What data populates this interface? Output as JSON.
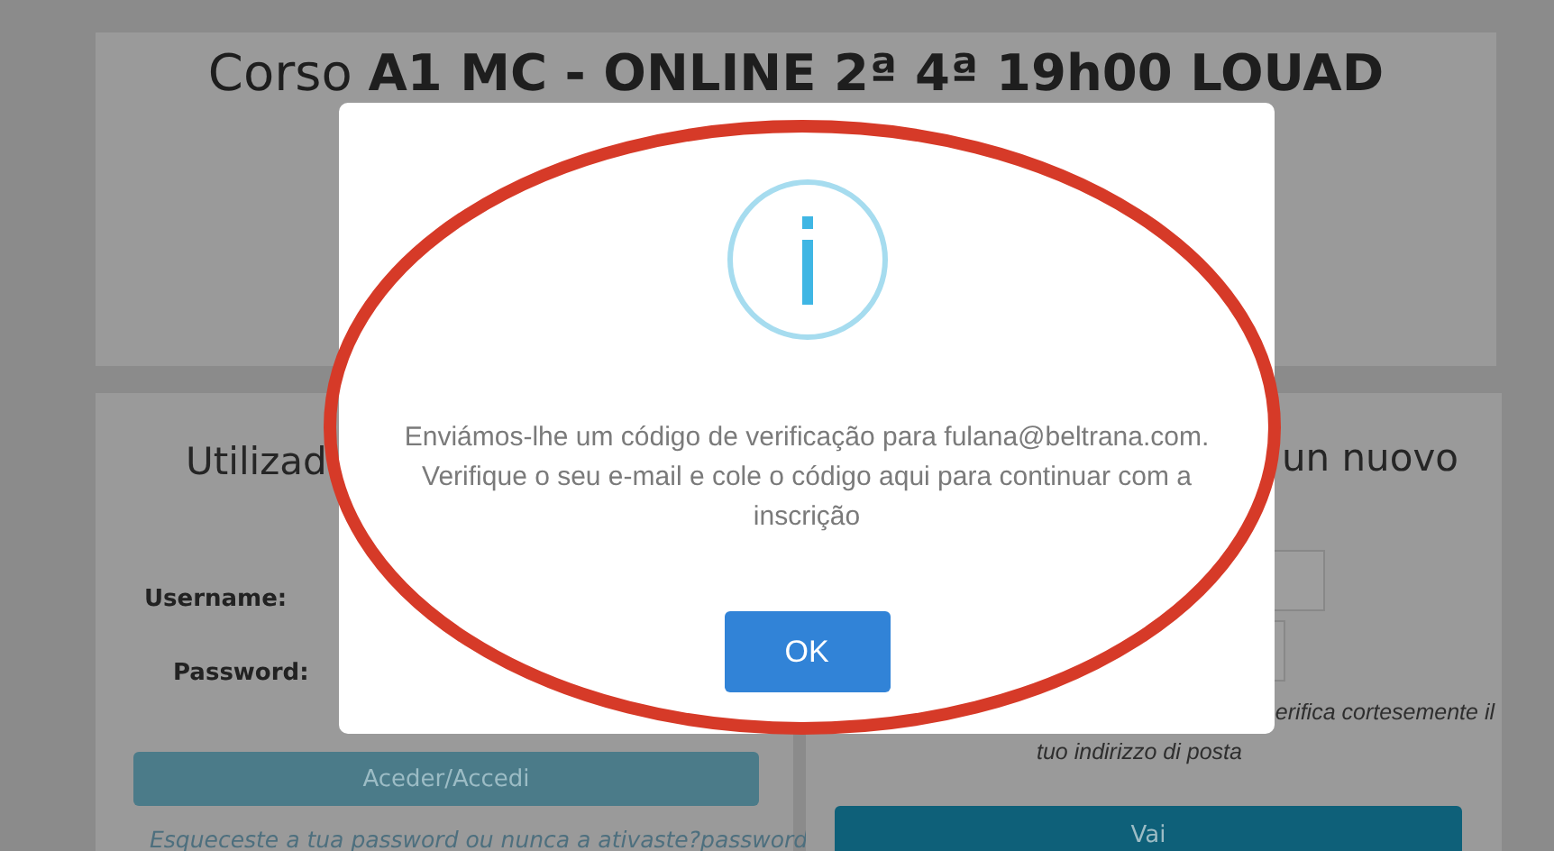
{
  "course_title": "Corso **A1 MC - ONLINE 2ª 4ª 19h00 LOUAD**",
  "login_card": {
    "heading": "Utilizad",
    "username_label": "Username:",
    "password_label": "Password:",
    "button": "Aceder/Accedi",
    "forgot_link": "Esqueceste a tua password ou nunca a ativaste?password"
  },
  "register_card": {
    "heading": "un nuovo",
    "hint_lines": [
      "erifica cortesemente il",
      "tuo indirizzo di posta"
    ],
    "button": "Vai"
  },
  "dialog": {
    "message": "Enviámos-lhe um código de verificação para fulana@beltrana.com. Verifique o seu e-mail e cole o código aqui para continuar com a inscrição",
    "button": "OK"
  }
}
